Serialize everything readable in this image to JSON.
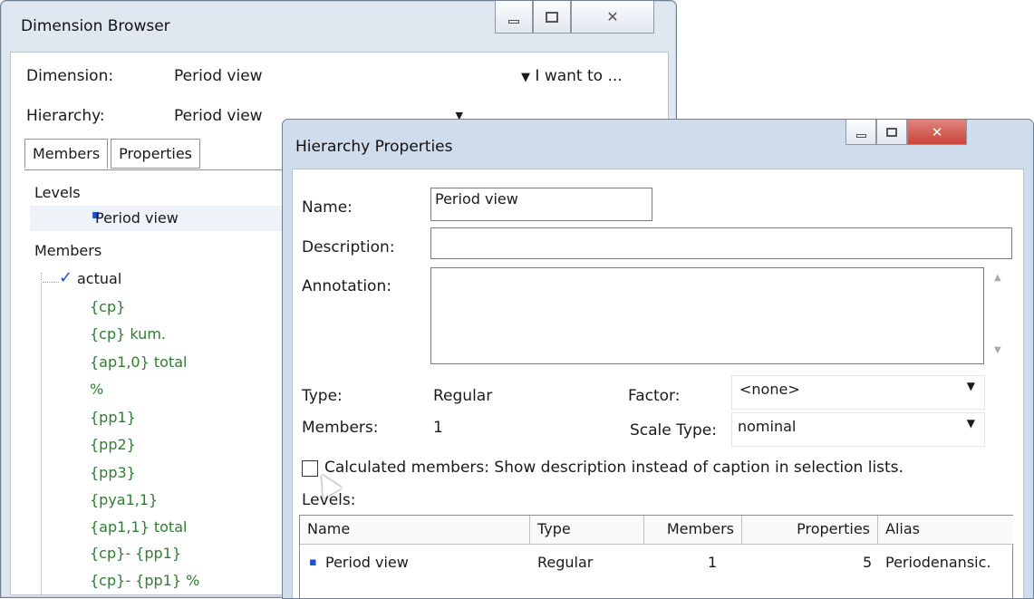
{
  "dimension_browser": {
    "title": "Dimension Browser",
    "dimension_label": "Dimension:",
    "dimension_value": "Period view",
    "hierarchy_label": "Hierarchy:",
    "hierarchy_value": "Period view",
    "i_want_to": "I want to ...",
    "tabs": [
      "Members",
      "Properties"
    ],
    "levels_heading": "Levels",
    "level_item": "Period view",
    "members_heading": "Members",
    "members": [
      "actual",
      "{cp}",
      "{cp} kum.",
      "{ap1,0} total",
      "%",
      "{pp1}",
      "{pp2}",
      "{pp3}",
      "{pya1,1}",
      "{ap1,1} total",
      "{cp}- {pp1}",
      "{cp}- {pp1} %"
    ]
  },
  "hierarchy_properties": {
    "title": "Hierarchy Properties",
    "name_label": "Name:",
    "name_value": "Period view",
    "description_label": "Description:",
    "description_value": "",
    "annotation_label": "Annotation:",
    "annotation_value": "",
    "type_label": "Type:",
    "type_value": "Regular",
    "members_label": "Members:",
    "members_value": "1",
    "factor_label": "Factor:",
    "factor_value": "<none>",
    "scale_type_label": "Scale Type:",
    "scale_type_value": "nominal",
    "calc_checkbox_label": "Calculated members: Show description instead of caption in selection lists.",
    "levels_label": "Levels:",
    "grid": {
      "headers": [
        "Name",
        "Type",
        "Members",
        "Properties",
        "Alias"
      ],
      "rows": [
        [
          "Period view",
          "Regular",
          "1",
          "5",
          "Periodenansic."
        ]
      ]
    }
  },
  "icons": [
    "minimize-icon",
    "maximize-icon",
    "close-icon",
    "dropdown-arrow-icon",
    "checkmark-icon",
    "bullet-icon",
    "scroll-up-icon",
    "scroll-down-icon",
    "mouse-cursor-icon"
  ],
  "colors": {
    "close_button": "#c9443a",
    "member_text": "#2e7d32",
    "bullet": "#1f4fd0"
  }
}
